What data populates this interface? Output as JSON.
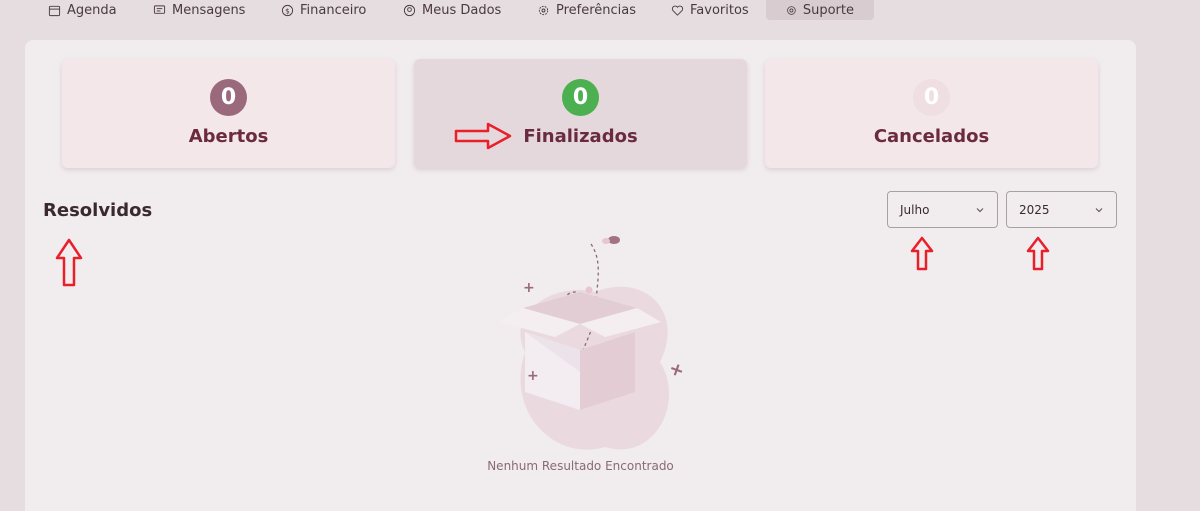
{
  "nav": {
    "items": [
      {
        "label": "Agenda",
        "icon": "calendar-icon"
      },
      {
        "label": "Mensagens",
        "icon": "message-icon"
      },
      {
        "label": "Financeiro",
        "icon": "dollar-icon"
      },
      {
        "label": "Meus Dados",
        "icon": "user-icon"
      },
      {
        "label": "Preferências",
        "icon": "gear-icon"
      },
      {
        "label": "Favoritos",
        "icon": "heart-icon"
      },
      {
        "label": "Suporte",
        "icon": "support-icon"
      }
    ],
    "active": "Suporte"
  },
  "cards": [
    {
      "count": "0",
      "label": "Abertos",
      "badge_color": "#9a6a7c"
    },
    {
      "count": "0",
      "label": "Finalizados",
      "badge_color": "#4caf50"
    },
    {
      "count": "0",
      "label": "Cancelados",
      "badge_color": "#efdfe2"
    }
  ],
  "section": {
    "title": "Resolvidos"
  },
  "filters": {
    "month": "Julho",
    "year": "2025"
  },
  "empty": {
    "message": "Nenhum Resultado Encontrado"
  },
  "colors": {
    "annotation": "#e8202a",
    "background": "#e6dde0",
    "panel": "#f1ecee"
  }
}
